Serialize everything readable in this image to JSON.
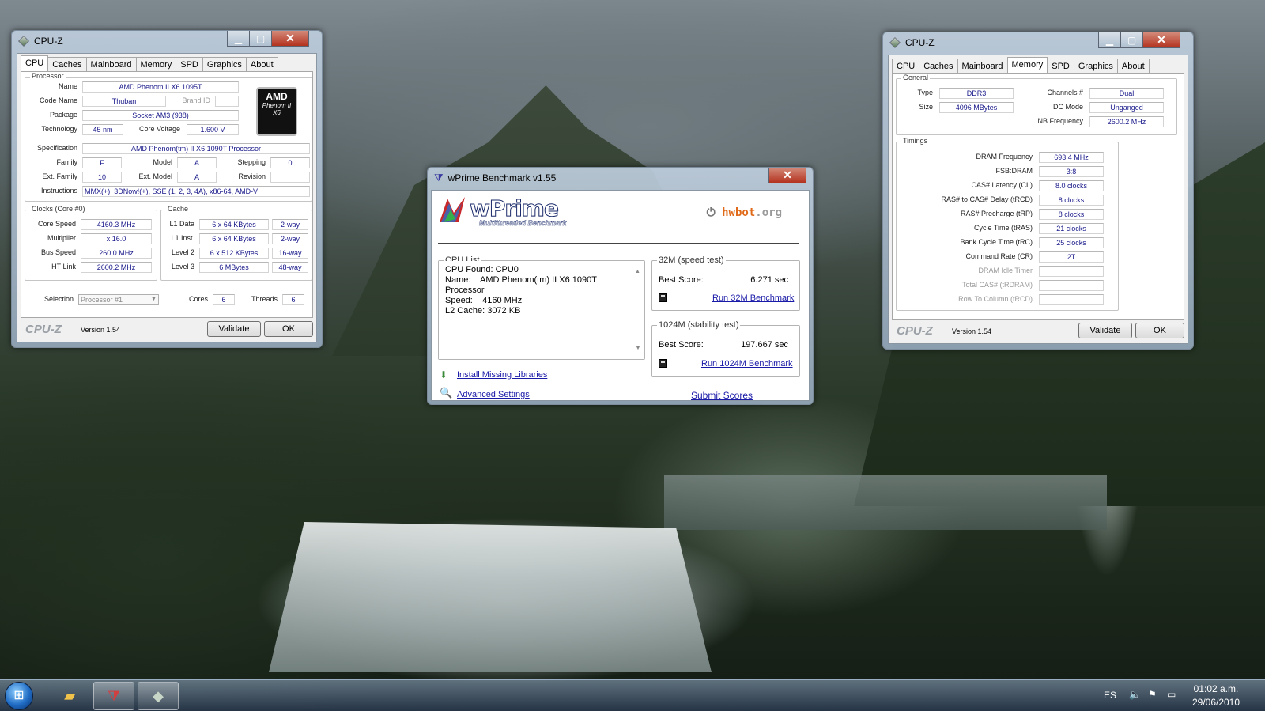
{
  "cpuz_left": {
    "title": "CPU-Z",
    "tabs": [
      "CPU",
      "Caches",
      "Mainboard",
      "Memory",
      "SPD",
      "Graphics",
      "About"
    ],
    "active_tab": "CPU",
    "processor": {
      "group": "Processor",
      "name_label": "Name",
      "name": "AMD Phenom II X6 1095T",
      "codename_label": "Code Name",
      "codename": "Thuban",
      "brandid_label": "Brand ID",
      "brandid": "",
      "package_label": "Package",
      "package": "Socket AM3 (938)",
      "technology_label": "Technology",
      "technology": "45 nm",
      "voltage_label": "Core Voltage",
      "voltage": "1.600 V",
      "spec_label": "Specification",
      "spec": "AMD Phenom(tm) II X6 1090T Processor",
      "family_label": "Family",
      "family": "F",
      "model_label": "Model",
      "model": "A",
      "stepping_label": "Stepping",
      "stepping": "0",
      "extfamily_label": "Ext. Family",
      "extfamily": "10",
      "extmodel_label": "Ext. Model",
      "extmodel": "A",
      "revision_label": "Revision",
      "revision": "",
      "instructions_label": "Instructions",
      "instructions": "MMX(+), 3DNow!(+), SSE (1, 2, 3, 4A), x86-64, AMD-V",
      "logo_brand": "AMD",
      "logo_model": "Phenom II",
      "logo_variant": "X6"
    },
    "clocks": {
      "group": "Clocks (Core #0)",
      "corespeed_label": "Core Speed",
      "corespeed": "4160.3 MHz",
      "multiplier_label": "Multiplier",
      "multiplier": "x 16.0",
      "busspeed_label": "Bus Speed",
      "busspeed": "260.0 MHz",
      "htlink_label": "HT Link",
      "htlink": "2600.2 MHz"
    },
    "cache": {
      "group": "Cache",
      "l1d_label": "L1 Data",
      "l1d": "6 x 64 KBytes",
      "l1d_way": "2-way",
      "l1i_label": "L1 Inst.",
      "l1i": "6 x 64 KBytes",
      "l1i_way": "2-way",
      "l2_label": "Level 2",
      "l2": "6 x 512 KBytes",
      "l2_way": "16-way",
      "l3_label": "Level 3",
      "l3": "6 MBytes",
      "l3_way": "48-way"
    },
    "selection_label": "Selection",
    "selection": "Processor #1",
    "cores_label": "Cores",
    "cores": "6",
    "threads_label": "Threads",
    "threads": "6",
    "logo": "CPU-Z",
    "version": "Version 1.54",
    "validate": "Validate",
    "ok": "OK"
  },
  "cpuz_right": {
    "title": "CPU-Z",
    "tabs": [
      "CPU",
      "Caches",
      "Mainboard",
      "Memory",
      "SPD",
      "Graphics",
      "About"
    ],
    "active_tab": "Memory",
    "general": {
      "group": "General",
      "type_label": "Type",
      "type": "DDR3",
      "size_label": "Size",
      "size": "4096 MBytes",
      "channels_label": "Channels #",
      "channels": "Dual",
      "dcmode_label": "DC Mode",
      "dcmode": "Unganged",
      "nbfreq_label": "NB Frequency",
      "nbfreq": "2600.2 MHz"
    },
    "timings": {
      "group": "Timings",
      "rows": [
        {
          "label": "DRAM Frequency",
          "value": "693.4 MHz",
          "enabled": true
        },
        {
          "label": "FSB:DRAM",
          "value": "3:8",
          "enabled": true
        },
        {
          "label": "CAS# Latency (CL)",
          "value": "8.0 clocks",
          "enabled": true
        },
        {
          "label": "RAS# to CAS# Delay (tRCD)",
          "value": "8 clocks",
          "enabled": true
        },
        {
          "label": "RAS# Precharge (tRP)",
          "value": "8 clocks",
          "enabled": true
        },
        {
          "label": "Cycle Time (tRAS)",
          "value": "21 clocks",
          "enabled": true
        },
        {
          "label": "Bank Cycle Time (tRC)",
          "value": "25 clocks",
          "enabled": true
        },
        {
          "label": "Command Rate (CR)",
          "value": "2T",
          "enabled": true
        },
        {
          "label": "DRAM Idle Timer",
          "value": "",
          "enabled": false
        },
        {
          "label": "Total CAS# (tRDRAM)",
          "value": "",
          "enabled": false
        },
        {
          "label": "Row To Column (tRCD)",
          "value": "",
          "enabled": false
        }
      ]
    },
    "logo": "CPU-Z",
    "version": "Version 1.54",
    "validate": "Validate",
    "ok": "OK"
  },
  "wprime": {
    "title": "wPrime Benchmark v1.55",
    "logo": "wPrime",
    "subtitle": "Multithreaded Benchmark",
    "hwbot_prefix": "hwbot",
    "hwbot_suffix": ".org",
    "cpu_list_label": "CPU List",
    "cpu_lines": [
      "CPU Found: CPU0",
      "Name:    AMD Phenom(tm) II X6 1090T",
      "Processor",
      "Speed:    4160 MHz",
      "L2 Cache: 3072 KB"
    ],
    "test32_label": "32M (speed test)",
    "test32_score_label": "Best Score:",
    "test32_score": "6.271 sec",
    "test32_run": "Run 32M Benchmark",
    "test1024_label": "1024M (stability test)",
    "test1024_score_label": "Best Score:",
    "test1024_score": "197.667 sec",
    "test1024_run": "Run 1024M Benchmark",
    "install_libs": "Install Missing Libraries",
    "advanced": "Advanced Settings",
    "submit": "Submit Scores"
  },
  "taskbar": {
    "language": "ES",
    "time": "01:02 a.m.",
    "date": "29/06/2010",
    "pinned": [
      "windows-explorer",
      "wprime",
      "cpu-z"
    ]
  }
}
